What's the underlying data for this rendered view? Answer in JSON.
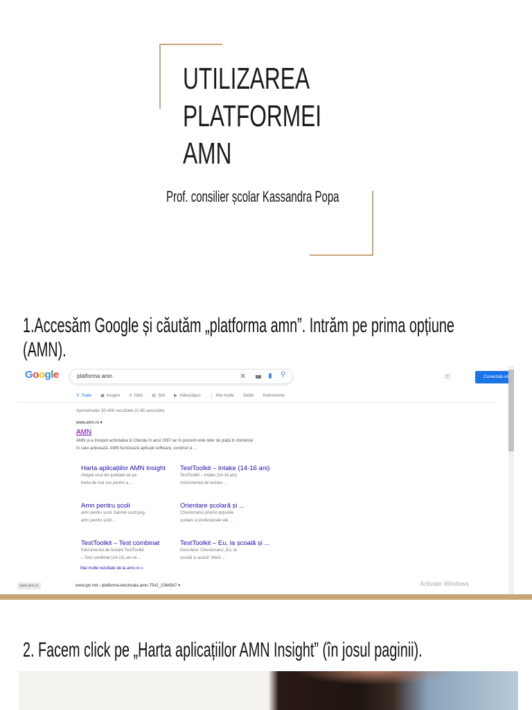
{
  "cover": {
    "title_lines": [
      "UTILIZAREA",
      "PLATFORMEI",
      "AMN"
    ],
    "author": "Prof. consilier școlar Kassandra Popa"
  },
  "step1": {
    "line1": "1.Accesăm Google și căutăm „platforma amn”. Intrăm pe prima opțiune",
    "line2": "(AMN)."
  },
  "google": {
    "logo": "Google",
    "query": "platforma amn",
    "signin": "Conectați-vă",
    "tabs": [
      "Toate",
      "Imagini",
      "Hărți",
      "Știri",
      "Videoclipuri",
      "Mai multe",
      "Setări",
      "Instrumente"
    ],
    "stats": "Aproximativ 30.400 rezultate (0,45 secunde)",
    "result": {
      "url": "www.amn.ro ▾",
      "title": "AMN",
      "snippet1": "AMN și-a început activitatea în Olanda în anul 1997 iar în prezent este lider de piață în domeniul",
      "snippet2": "în care activează. AMN furnizează aplicații software, conținut și ..."
    },
    "sitelinks": [
      {
        "title": "Harta aplicațiilor AMN Insight",
        "d1": "Alegeți unul din județele de pe",
        "d2": "harta de mai sus pentru a ..."
      },
      {
        "title": "TestToolkit – Intake (14-16 ani)",
        "d1": "TestToolkit – Intake (14-16 ani).",
        "d2": "Instrumentul de testare ..."
      },
      {
        "title": "Amn pentru școli",
        "d1": "amn pentru școli. banner-scoli.png.",
        "d2": "amn pentru școli ..."
      },
      {
        "title": "Orientare școlară și ...",
        "d1": "Chestionarul privind opțiunile",
        "d2": "școlare și profesionale ale ..."
      },
      {
        "title": "TestToolkit – Test combinat",
        "d1": "Instrumentul de testare TestToolkit",
        "d2": "– Test combinat (14-15) ani se ..."
      },
      {
        "title": "TestToolkit – Eu, la școală și ...",
        "d1": "Descriere: Chestionarul „Eu, la",
        "d2": "școală și acasă” oferă ..."
      }
    ],
    "more": "Mai multe rezultate de la amn.ro »",
    "next_url": "www.ipn.md › platforma-electorala-amn-7542_1064587 ▾",
    "status_url": "www.amn.ro",
    "watermark": "Activate Windows"
  },
  "step2": {
    "text": "2. Facem click pe „Harta aplicațiilor AMN Insight” (în josul paginii)."
  },
  "colors": {
    "gold": "#c9a57a",
    "link": "#1a0dab",
    "button": "#1a73e8"
  }
}
